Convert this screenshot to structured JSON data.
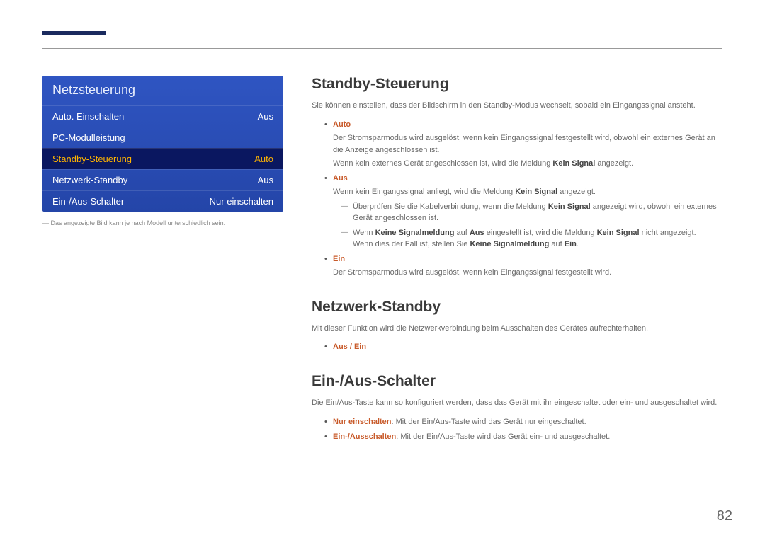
{
  "page_number": "82",
  "menu": {
    "title": "Netzsteuerung",
    "items": [
      {
        "label": "Auto. Einschalten",
        "value": "Aus",
        "selected": false
      },
      {
        "label": "PC-Modulleistung",
        "value": "",
        "selected": false
      },
      {
        "label": "Standby-Steuerung",
        "value": "Auto",
        "selected": true
      },
      {
        "label": "Netzwerk-Standby",
        "value": "Aus",
        "selected": false
      },
      {
        "label": "Ein-/Aus-Schalter",
        "value": "Nur einschalten",
        "selected": false
      }
    ],
    "note": "Das angezeigte Bild kann je nach Modell unterschiedlich sein."
  },
  "sections": {
    "standby": {
      "title": "Standby-Steuerung",
      "intro": "Sie können einstellen, dass der Bildschirm in den Standby-Modus wechselt, sobald ein Eingangssignal ansteht.",
      "auto": {
        "label": "Auto",
        "line1a": "Der Stromsparmodus wird ausgelöst, wenn kein Eingangssignal festgestellt wird, obwohl ein externes Gerät an die Anzeige angeschlossen ist.",
        "line2_pre": "Wenn kein externes Gerät angeschlossen ist, wird die Meldung ",
        "kein_signal": "Kein Signal",
        "line2_post": " angezeigt."
      },
      "aus": {
        "label": "Aus",
        "line1_pre": "Wenn kein Eingangssignal anliegt, wird die Meldung ",
        "kein_signal": "Kein Signal",
        "line1_post": " angezeigt.",
        "dash1_pre": "Überprüfen Sie die Kabelverbindung, wenn die Meldung ",
        "dash1_post": " angezeigt wird, obwohl ein externes Gerät angeschlossen ist.",
        "dash2_pre": "Wenn ",
        "keine_sig": "Keine Signalmeldung",
        "dash2_mid": " auf ",
        "aus_b": "Aus",
        "dash2_mid2": " eingestellt ist, wird die Meldung ",
        "dash2_post": " nicht angezeigt.",
        "dash2b_pre": "Wenn dies der Fall ist, stellen Sie ",
        "dash2b_mid": " auf ",
        "ein_b": "Ein",
        "dash2b_post": "."
      },
      "ein": {
        "label": "Ein",
        "line": "Der Stromsparmodus wird ausgelöst, wenn kein Eingangssignal festgestellt wird."
      }
    },
    "netzwerk": {
      "title": "Netzwerk-Standby",
      "intro": "Mit dieser Funktion wird die Netzwerkverbindung beim Ausschalten des Gerätes aufrechterhalten.",
      "opt_aus": "Aus",
      "opt_sep": " / ",
      "opt_ein": "Ein"
    },
    "schalter": {
      "title": "Ein-/Aus-Schalter",
      "intro": "Die Ein/Aus-Taste kann so konfiguriert werden, dass das Gerät mit ihr eingeschaltet oder ein- und ausgeschaltet wird.",
      "nur": {
        "label": "Nur einschalten",
        "text": ": Mit der Ein/Aus-Taste wird das Gerät nur eingeschaltet."
      },
      "einaus": {
        "label": "Ein-/Ausschalten",
        "text": ": Mit der Ein/Aus-Taste wird das Gerät ein- und ausgeschaltet."
      }
    }
  }
}
